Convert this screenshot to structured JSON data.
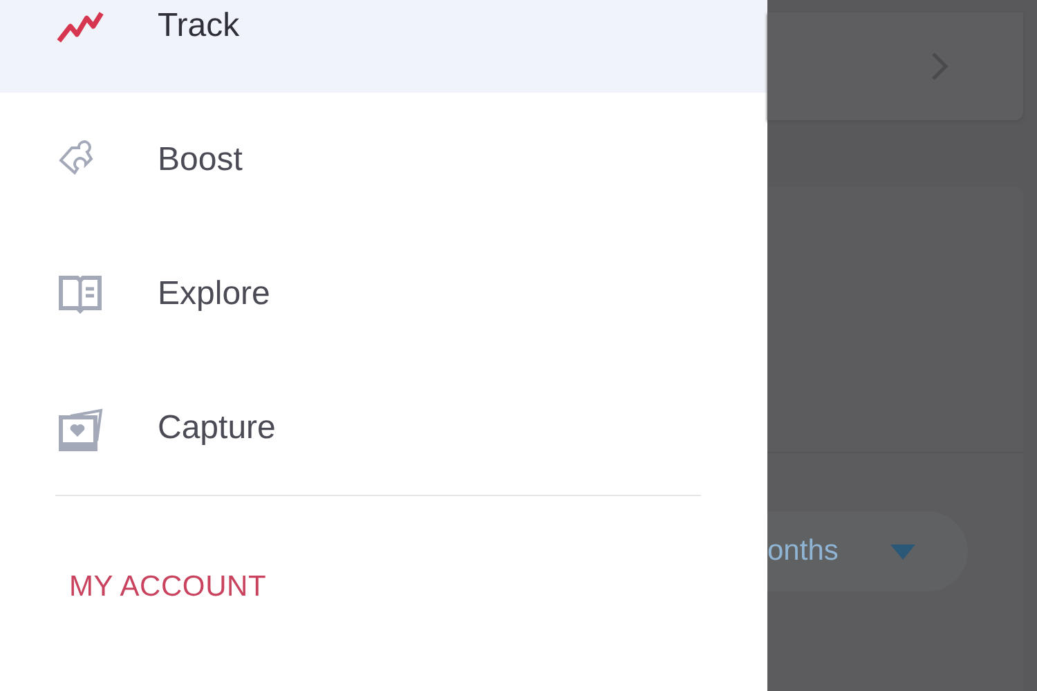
{
  "menu": {
    "items": [
      {
        "label": "Track",
        "kind": "track",
        "selected": true
      },
      {
        "label": "Boost",
        "kind": "boost",
        "selected": false
      },
      {
        "label": "Explore",
        "kind": "explore",
        "selected": false
      },
      {
        "label": "Capture",
        "kind": "capture",
        "selected": false
      }
    ],
    "account_heading": "MY ACCOUNT"
  },
  "background": {
    "period_dropdown": {
      "value": "onths"
    }
  }
}
